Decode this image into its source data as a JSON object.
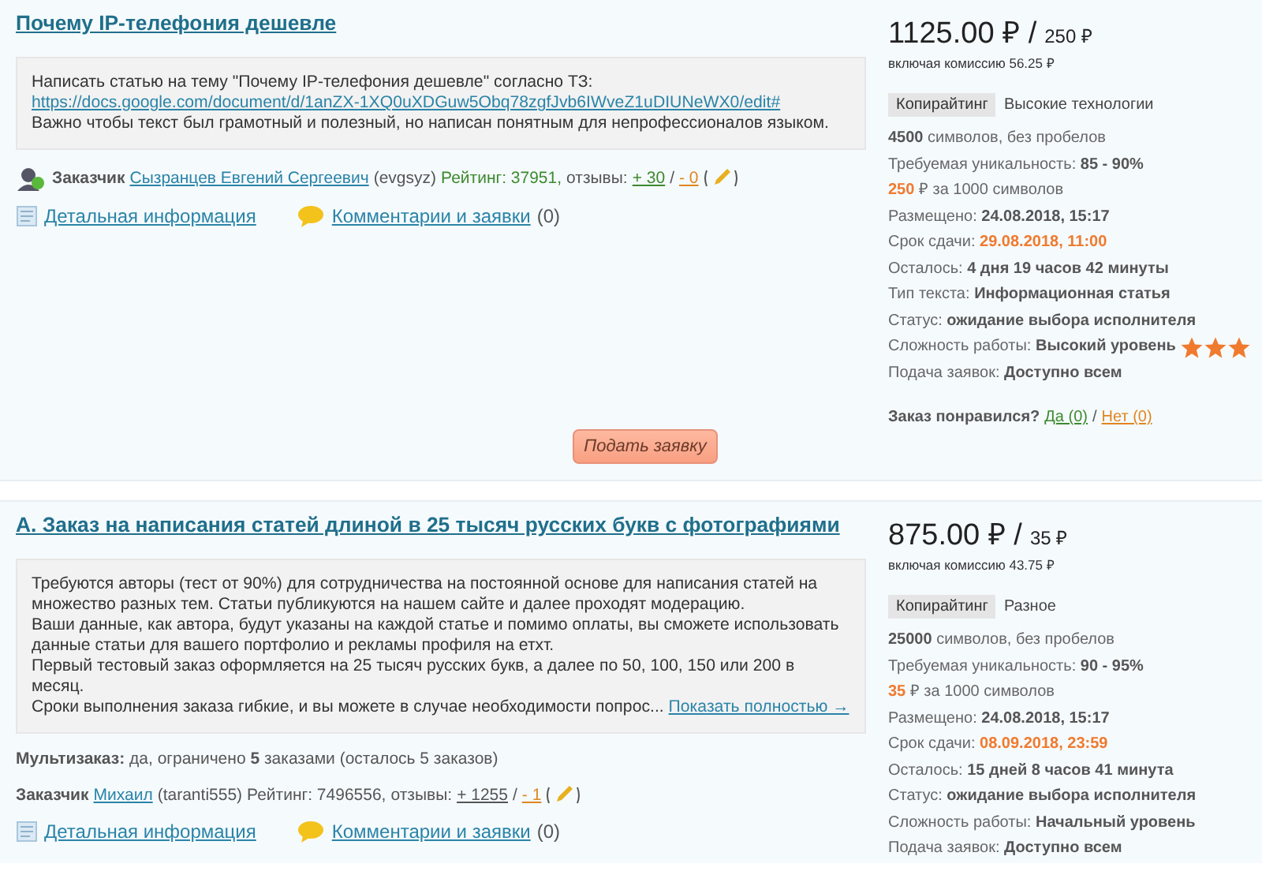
{
  "orders": [
    {
      "title": "Почему IP-телефония дешевле",
      "description": [
        {
          "kind": "text",
          "text": "Написать статью на тему \"Почему IP-телефония дешевле\" согласно ТЗ:"
        },
        {
          "kind": "link",
          "text": "https://docs.google.com/document/d/1anZX-1XQ0uXDGuw5Obq78zgfJvb6IWveZ1uDIUNeWX0/edit#"
        },
        {
          "kind": "text",
          "text": "Важно чтобы текст был грамотный и полезный, но написан понятным для непрофессионалов языком."
        }
      ],
      "customer": {
        "label": "Заказчик",
        "name": "Сызранцев Евгений Сергеевич",
        "login": "(evgsyz)",
        "rating": "Рейтинг: 37951,",
        "highlighted": true,
        "reviews_label": "отзывы:",
        "plus": "+ 30",
        "separator": "/",
        "minus": "- 0"
      },
      "details_link": "Детальная информация",
      "comments_link": "Комментарии и заявки",
      "comments_count": "(0)",
      "price": "1125.00 ₽ /",
      "price_part": "250 ₽",
      "commission": "включая комиссию 56.25 ₽",
      "category": "Копирайтинг",
      "subcategory": "Высокие технологии",
      "specs": [
        {
          "kind": "count",
          "value": "4500",
          "text": "символов, без пробелов"
        },
        {
          "kind": "field",
          "label": "Требуемая уникальность:",
          "value": "85 - 90%",
          "accent": false
        },
        {
          "kind": "rate",
          "value": "250",
          "text": "₽ за 1000 символов"
        },
        {
          "kind": "field",
          "label": "Размещено:",
          "value": "24.08.2018, 15:17",
          "accent": false
        },
        {
          "kind": "field",
          "label": "Срок сдачи:",
          "value": "29.08.2018, 11:00",
          "accent": true
        },
        {
          "kind": "field",
          "label": "Осталось:",
          "value": "4 дня 19 часов 42 минуты",
          "accent": false
        },
        {
          "kind": "field",
          "label": "Тип текста:",
          "value": "Информационная статья",
          "accent": false
        },
        {
          "kind": "field",
          "label": "Статус:",
          "value": "ожидание выбора исполнителя",
          "accent": false
        },
        {
          "kind": "difficulty",
          "label": "Сложность работы:",
          "value": "Высокий уровень",
          "stars": 3
        },
        {
          "kind": "field",
          "label": "Подача заявок:",
          "value": "Доступно всем",
          "accent": false
        }
      ],
      "liked": {
        "question": "Заказ понравился?",
        "yes": "Да (0)",
        "separator": "/",
        "no": "Нет (0)"
      },
      "apply_button": "Подать заявку"
    },
    {
      "title": "А. Заказ на написания статей длиной в 25 тысяч русских букв с фотографиями",
      "description": [
        {
          "kind": "text",
          "text": "Требуются авторы (тест от 90%) для сотрудничества на постоянной основе для написания статей на множество разных тем. Статьи публикуются на нашем сайте и далее проходят модерацию."
        },
        {
          "kind": "text",
          "text": "Ваши данные, как автора, будут указаны на каждой статье и помимо оплаты, вы сможете использовать данные статьи для вашего портфолио и рекламы профиля на етхт."
        },
        {
          "kind": "text",
          "text": "Первый тестовый заказ оформляется на 25 тысяч русских букв, а далее по 50, 100, 150 или 200 в месяц."
        },
        {
          "kind": "more",
          "text": "Сроки выполнения заказа гибкие, и вы можете в случае необходимости попрос...",
          "link": "Показать полностью →"
        }
      ],
      "multi": "**Мультизаказ:** да, ограничено **5** заказами (осталось 5 заказов)",
      "customer": {
        "label": "Заказчик",
        "name": "Михаил",
        "login": "(taranti555)",
        "rating": "Рейтинг: 7496556,",
        "highlighted": false,
        "reviews_label": "отзывы:",
        "plus": "+ 1255",
        "separator": "/",
        "minus": "- 1"
      },
      "details_link": "Детальная информация",
      "comments_link": "Комментарии и заявки",
      "comments_count": "(0)",
      "price": "875.00 ₽ /",
      "price_part": "35 ₽",
      "commission": "включая комиссию 43.75 ₽",
      "category": "Копирайтинг",
      "subcategory": "Разное",
      "specs": [
        {
          "kind": "count",
          "value": "25000",
          "text": "символов, без пробелов"
        },
        {
          "kind": "field",
          "label": "Требуемая уникальность:",
          "value": "90 - 95%",
          "accent": false
        },
        {
          "kind": "rate",
          "value": "35",
          "text": "₽ за 1000 символов"
        },
        {
          "kind": "field",
          "label": "Размещено:",
          "value": "24.08.2018, 15:17",
          "accent": false
        },
        {
          "kind": "field",
          "label": "Срок сдачи:",
          "value": "08.09.2018, 23:59",
          "accent": true
        },
        {
          "kind": "field",
          "label": "Осталось:",
          "value": "15 дней 8 часов 41 минута",
          "accent": false
        },
        {
          "kind": "field",
          "label": "Статус:",
          "value": "ожидание выбора исполнителя",
          "accent": false
        },
        {
          "kind": "field",
          "label": "Сложность работы:",
          "value": "Начальный уровень",
          "accent": false
        },
        {
          "kind": "field",
          "label": "Подача заявок:",
          "value": "Доступно всем",
          "accent": false
        }
      ]
    }
  ]
}
